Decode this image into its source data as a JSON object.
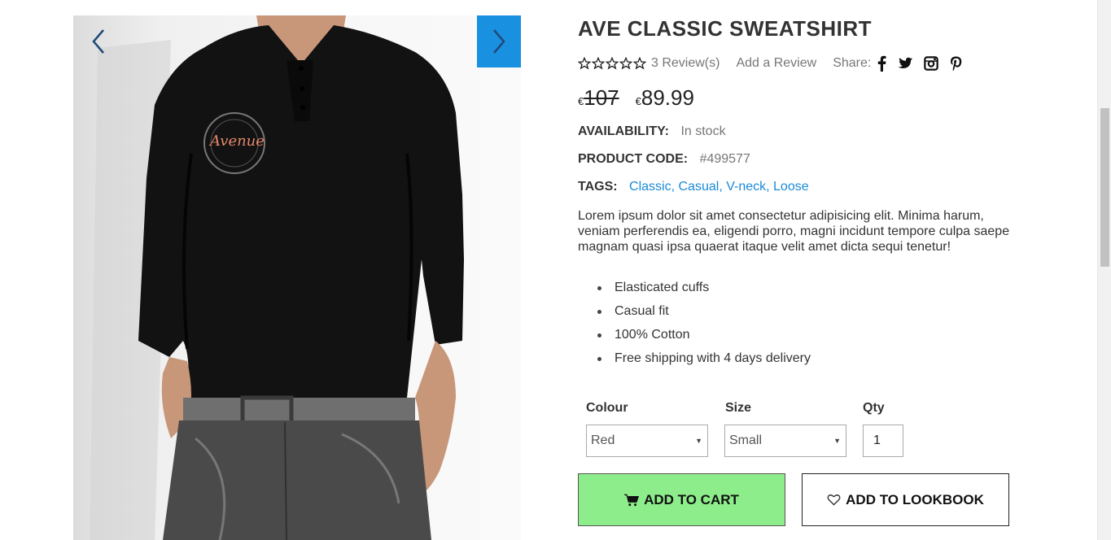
{
  "gallery": {
    "image_alt": "Model wearing black long-sleeve henley sweatshirt",
    "logo_text": "Avenue",
    "prev_icon": "chevron-left-icon",
    "next_icon": "chevron-right-icon",
    "accent_color": "#1a90e0"
  },
  "product": {
    "title": "AVE CLASSIC SWEATSHIRT",
    "rating": {
      "stars_filled": 0,
      "stars_total": 5
    },
    "reviews_link": "3 Review(s)",
    "add_review_link": "Add a Review",
    "share_label": "Share:",
    "social_icons": [
      "facebook-icon",
      "twitter-icon",
      "instagram-icon",
      "pinterest-icon"
    ],
    "currency_symbol": "€",
    "old_price": "107",
    "new_price": "89.99",
    "availability_label": "AVAILABILITY:",
    "availability_value": "In stock",
    "code_label": "PRODUCT CODE:",
    "code_value": "#499577",
    "tags_label": "TAGS:",
    "tags": [
      "Classic",
      "Casual",
      "V-neck",
      "Loose"
    ],
    "description": "Lorem ipsum dolor sit amet consectetur adipisicing elit. Minima harum, veniam perferendis ea, eligendi porro, magni incidunt tempore culpa saepe magnam quasi ipsa quaerat itaque velit amet dicta sequi tenetur!",
    "features": [
      "Elasticated cuffs",
      "Casual fit",
      "100% Cotton",
      "Free shipping with 4 days delivery"
    ]
  },
  "options": {
    "colour_label": "Colour",
    "colour_value": "Red",
    "size_label": "Size",
    "size_value": "Small",
    "qty_label": "Qty",
    "qty_value": "1"
  },
  "actions": {
    "add_to_cart": "ADD TO CART",
    "add_to_lookbook": "ADD TO LOOKBOOK",
    "cart_color": "#8ded8b"
  }
}
